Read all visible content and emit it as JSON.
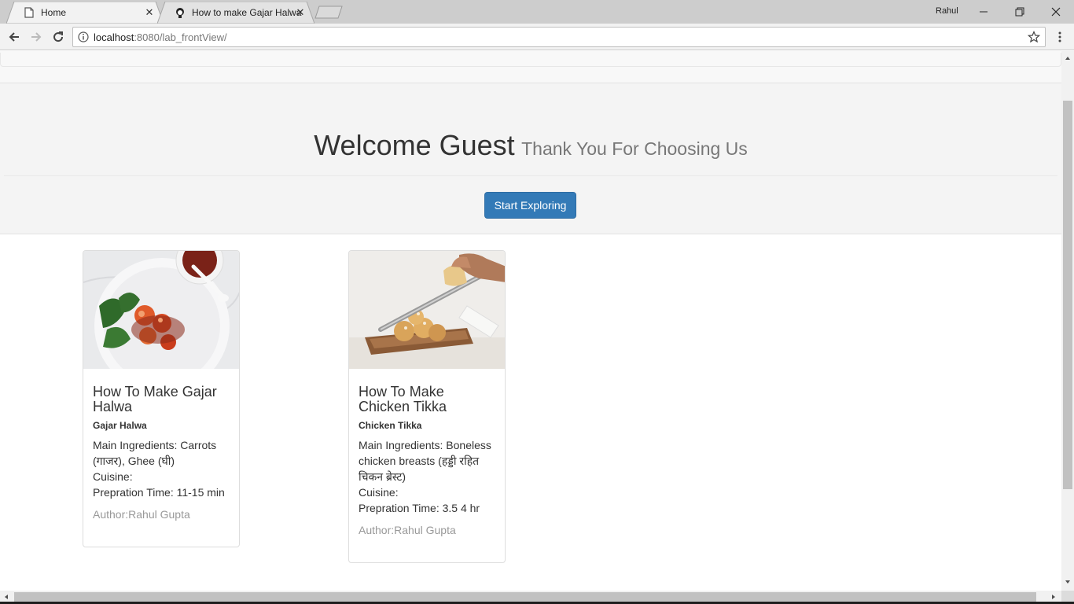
{
  "browser": {
    "tabs": [
      {
        "title": "Home",
        "favicon": "page-icon",
        "active": true
      },
      {
        "title": "How to make Gajar Halwa",
        "favicon": "chef-icon",
        "active": false
      }
    ],
    "profile_name": "Rahul",
    "url_host": "localhost",
    "url_rest": ":8080/lab_frontView/"
  },
  "hero": {
    "welcome": "Welcome Guest",
    "tagline": "Thank You For Choosing Us",
    "button_label": "Start Exploring"
  },
  "recipes": [
    {
      "title": "How To Make Gajar Halwa",
      "name": "Gajar Halwa",
      "ingredients": "Main Ingredients: Carrots (गाजर), Ghee (घी)",
      "cuisine": "Cuisine:",
      "time": "Prepration Time: 11-15 min",
      "author": "Author:Rahul Gupta"
    },
    {
      "title": "How To Make Chicken Tikka",
      "name": "Chicken Tikka",
      "ingredients": "Main Ingredients: Boneless chicken breasts (हड्डी रहित चिकन ब्रेस्ट)",
      "cuisine": "Cuisine:",
      "time": "Prepration Time: 3.5 4 hr",
      "author": "Author:Rahul Gupta"
    }
  ],
  "colors": {
    "primary": "#337ab7",
    "jumbotron_bg": "#f4f4f4",
    "muted_text": "#999999"
  }
}
